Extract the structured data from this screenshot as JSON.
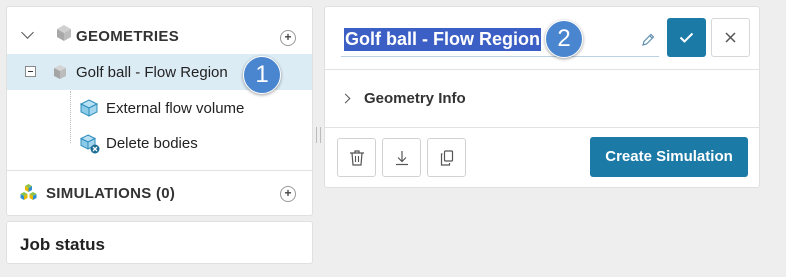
{
  "tree": {
    "geometries_label": "GEOMETRIES",
    "geometry_name": "Golf ball - Flow Region",
    "operations": [
      {
        "label": "External flow volume",
        "icon": "cube-icon"
      },
      {
        "label": "Delete bodies",
        "icon": "cube-delete-icon"
      }
    ],
    "simulations_label": "SIMULATIONS (0)",
    "add_symbol": "+"
  },
  "job_status": {
    "label": "Job status"
  },
  "detail": {
    "name_value": "Golf ball - Flow Region",
    "geometry_info_label": "Geometry Info",
    "create_button_label": "Create Simulation"
  },
  "callouts": [
    "1",
    "2"
  ],
  "colors": {
    "accent": "#1c7aa6",
    "selection_bg": "#dcecf5",
    "text_highlight": "#3b5fc4",
    "callout": "#4a86cf"
  }
}
